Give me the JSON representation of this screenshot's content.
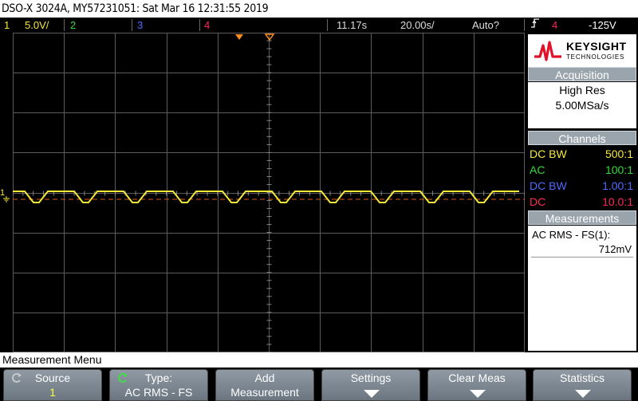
{
  "title": "DSO-X 3024A, MY57231051: Sat Mar 16 12:31:55 2019",
  "status": {
    "ch1_num": "1",
    "ch1_scale": "5.0V/",
    "ch2_num": "2",
    "ch3_num": "3",
    "ch4_num": "4",
    "time_delay": "11.17s",
    "time_scale": "20.00s/",
    "trigger_mode": "Auto?",
    "trigger_icon": "trigger-edge-icon",
    "trigger_source": "4",
    "trigger_level": "-125V"
  },
  "colors": {
    "ch1": "#f5e83a",
    "ch2": "#35d93a",
    "ch3": "#4f6bff",
    "ch4": "#ff2a58",
    "grid": "#5c5c5c",
    "marker": "#ff8c1a"
  },
  "sidebar": {
    "brand": "KEYSIGHT",
    "brand_sub": "TECHNOLOGIES",
    "acq_title": "Acquisition",
    "acq_mode": "High Res",
    "acq_rate": "5.00MSa/s",
    "channels_title": "Channels",
    "channels": [
      {
        "coupling": "DC BW",
        "probe": "500:1"
      },
      {
        "coupling": "AC",
        "probe": "100:1"
      },
      {
        "coupling": "DC BW",
        "probe": "1.00:1"
      },
      {
        "coupling": "DC",
        "probe": "10.0:1"
      }
    ],
    "meas_title": "Measurements",
    "meas_label": "AC RMS - FS(1):",
    "meas_value": "712mV"
  },
  "screen": {
    "ch1_marker": "1",
    "ground_icon": "ground-icon"
  },
  "menu": {
    "title": "Measurement Menu",
    "softkeys": [
      {
        "line1": "Source",
        "line2": "1"
      },
      {
        "line1": "Type:",
        "line2": "AC RMS - FS"
      },
      {
        "line1": "Add",
        "line2": "Measurement"
      },
      {
        "line1": "Settings",
        "line2": ""
      },
      {
        "line1": "Clear Meas",
        "line2": ""
      },
      {
        "line1": "Statistics",
        "line2": ""
      }
    ]
  }
}
